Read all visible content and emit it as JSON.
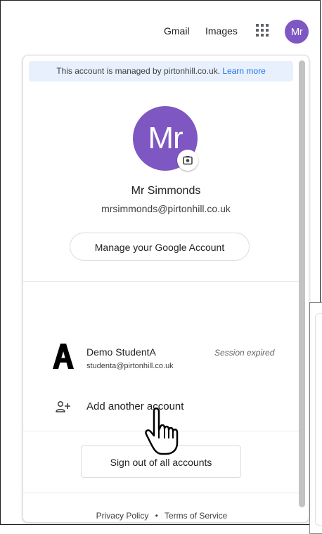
{
  "topbar": {
    "gmail": "Gmail",
    "images": "Images",
    "apps_icon": "apps-grid-icon",
    "avatar_initials": "Mr"
  },
  "panel": {
    "managed_text": "This account is managed by pirtonhill.co.uk.",
    "learn_more": "Learn more",
    "avatar_initials": "Mr",
    "name": "Mr Simmonds",
    "email": "mrsimmonds@pirtonhill.co.uk",
    "manage_button": "Manage your Google Account",
    "other_account": {
      "name": "Demo StudentA",
      "email": "studenta@pirtonhill.co.uk",
      "status": "Session expired"
    },
    "add_account": "Add another account",
    "sign_out": "Sign out of all accounts",
    "footer": {
      "privacy": "Privacy Policy",
      "separator": "•",
      "terms": "Terms of Service"
    }
  },
  "colors": {
    "avatar": "#7e57c2",
    "managed_bg": "#e8f0fe",
    "link": "#1a73e8"
  }
}
